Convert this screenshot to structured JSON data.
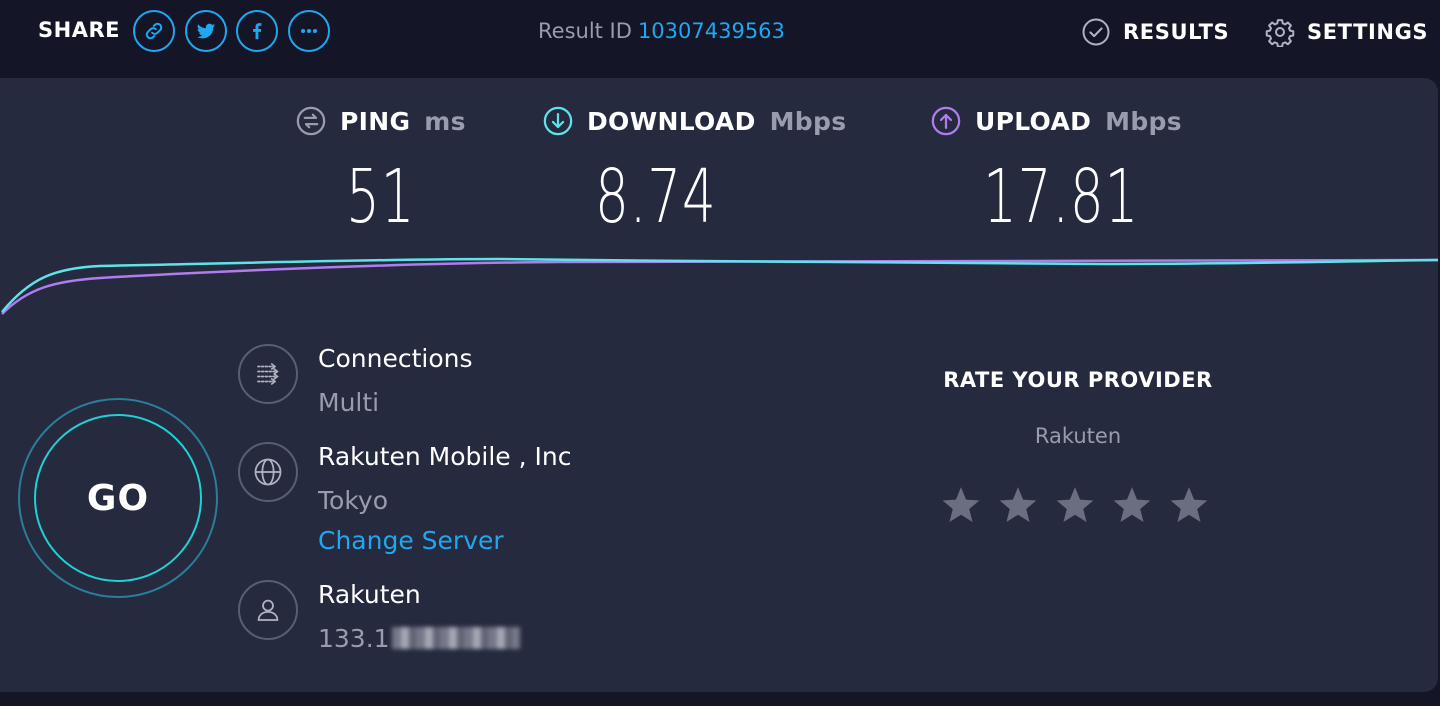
{
  "header": {
    "share_label": "SHARE",
    "share_buttons": [
      {
        "icon": "link-icon"
      },
      {
        "icon": "twitter-icon"
      },
      {
        "icon": "facebook-icon"
      },
      {
        "icon": "more-icon"
      }
    ],
    "result_label": "Result ID",
    "result_id": "10307439563",
    "results_label": "RESULTS",
    "settings_label": "SETTINGS"
  },
  "metrics": {
    "ping": {
      "label": "PING",
      "unit": "ms",
      "value": "51",
      "icon": "ping-icon"
    },
    "download": {
      "label": "DOWNLOAD",
      "unit": "Mbps",
      "value": "8.74",
      "icon": "download-arrow-icon"
    },
    "upload": {
      "label": "UPLOAD",
      "unit": "Mbps",
      "value": "17.81",
      "icon": "upload-arrow-icon"
    }
  },
  "go_label": "GO",
  "connections": {
    "title": "Connections",
    "value": "Multi"
  },
  "server": {
    "name": "Rakuten Mobile , Inc",
    "location": "Tokyo",
    "change_label": "Change Server"
  },
  "client": {
    "isp": "Rakuten",
    "ip_prefix": "133.1"
  },
  "rate": {
    "title": "RATE YOUR PROVIDER",
    "provider": "Rakuten",
    "stars": 5,
    "rating": 0
  },
  "colors": {
    "accent": "#1fa7f0",
    "download_line": "#5ee3ea",
    "upload_line": "#b07cf0",
    "panel": "#262a3e",
    "background": "#141526",
    "muted": "#9a9cae"
  }
}
